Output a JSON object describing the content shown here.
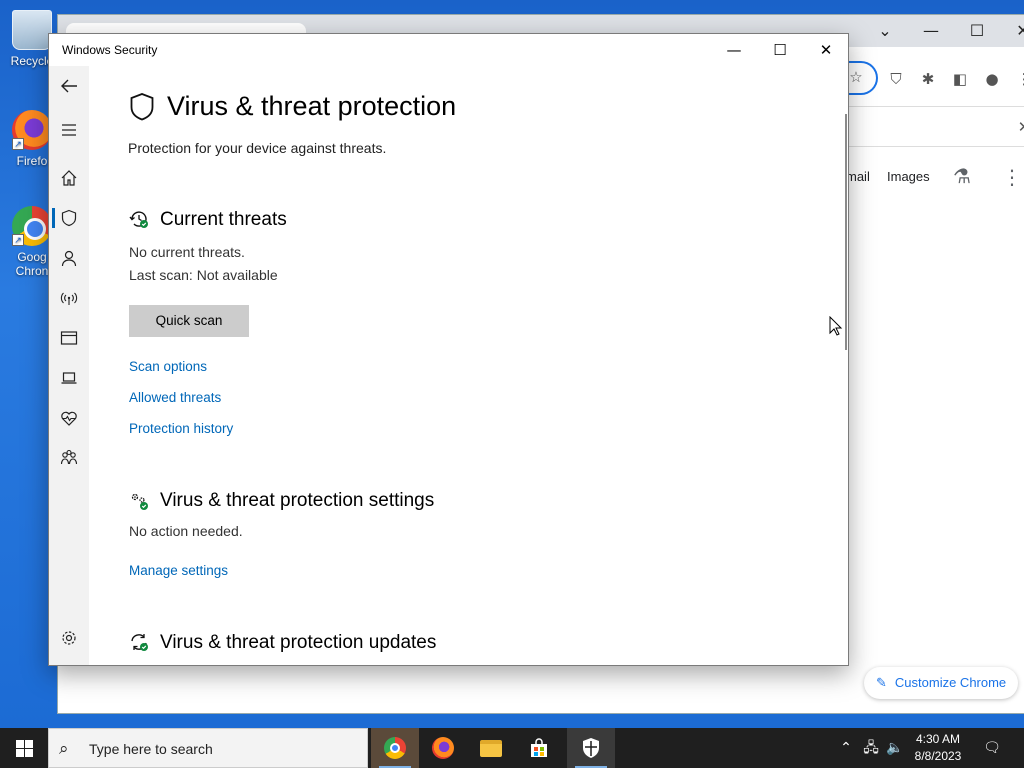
{
  "desktop": {
    "icons": [
      {
        "label": "Recycle"
      },
      {
        "label": "Firefo"
      },
      {
        "label": "Goog",
        "label2": "Chron"
      }
    ]
  },
  "chrome": {
    "links": [
      "mail",
      "Images"
    ],
    "customize_label": "Customize Chrome"
  },
  "window": {
    "title": "Windows Security",
    "controls": {
      "minimize": "—",
      "maximize": "☐",
      "close": "✕"
    }
  },
  "page": {
    "title": "Virus & threat protection",
    "subtitle": "Protection for your device against threats.",
    "current_threats": {
      "heading": "Current threats",
      "status": "No current threats.",
      "last_scan": "Last scan: Not available",
      "quick_scan_label": "Quick scan",
      "links": [
        "Scan options",
        "Allowed threats",
        "Protection history"
      ]
    },
    "settings": {
      "heading": "Virus & threat protection settings",
      "status": "No action needed.",
      "link": "Manage settings"
    },
    "updates": {
      "heading": "Virus & threat protection updates"
    }
  },
  "sidebar": {
    "items": [
      {
        "icon": "back-arrow-icon"
      },
      {
        "icon": "hamburger-menu-icon"
      },
      {
        "icon": "home-icon"
      },
      {
        "icon": "shield-icon",
        "active": true
      },
      {
        "icon": "person-icon"
      },
      {
        "icon": "wireless-signal-icon"
      },
      {
        "icon": "app-browser-icon"
      },
      {
        "icon": "laptop-icon"
      },
      {
        "icon": "heart-pulse-icon"
      },
      {
        "icon": "family-icon"
      },
      {
        "icon": "gear-icon"
      }
    ]
  },
  "taskbar": {
    "search_placeholder": "Type here to search",
    "time": "4:30 AM",
    "date": "8/8/2023"
  },
  "colors": {
    "link": "#0067b8",
    "desktop": "#1e6fd0",
    "taskbar": "#1f1f1f",
    "badge_green": "#10893e"
  }
}
